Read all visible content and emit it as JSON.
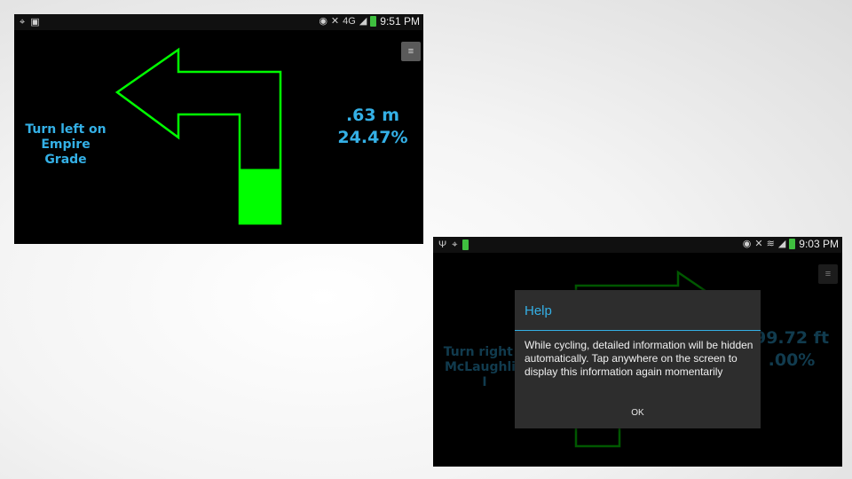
{
  "screen1": {
    "status_bar": {
      "left_icons": [
        "gps-icon",
        "image-icon"
      ],
      "right_icons": [
        "eye-icon",
        "mute-icon",
        "4g-icon",
        "signal-icon",
        "battery-icon"
      ],
      "network_label": "4G",
      "time": "9:51 PM"
    },
    "menu_icon": "overflow-menu-icon",
    "turn_instruction": [
      "Turn left on",
      "Empire Grade"
    ],
    "distance": ".63 m",
    "grade": "24.47%",
    "progress_fraction": 0.5,
    "colors": {
      "arrow": "#00ff00",
      "text": "#34b0e6",
      "background": "#000000"
    }
  },
  "screen2": {
    "status_bar": {
      "left_icons": [
        "usb-icon",
        "gps-icon",
        "battery-small-icon"
      ],
      "right_icons": [
        "eye-icon",
        "mute-icon",
        "wifi-icon",
        "signal-icon",
        "battery-icon"
      ],
      "time": "9:03 PM"
    },
    "menu_icon": "overflow-menu-icon",
    "turn_instruction": [
      "Turn right o",
      "McLaughlin I"
    ],
    "distance": "99.72 ft",
    "grade": ".00%",
    "dialog": {
      "title": "Help",
      "message": "While cycling, detailed information will be hidden automatically. Tap anywhere on the screen to display this information again momentarily",
      "ok_label": "OK"
    },
    "colors": {
      "accent": "#34b0e6",
      "dialog_bg": "#2d2d2d"
    }
  }
}
